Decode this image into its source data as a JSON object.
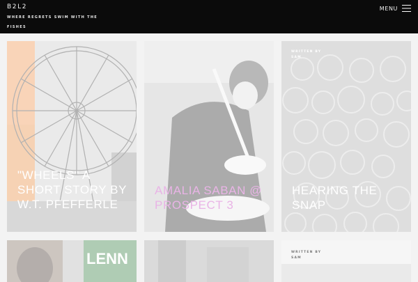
{
  "site": {
    "logo": "B2L2",
    "tagline": "Where regrets swim with the fishes",
    "menu_label": "MENU"
  },
  "colors": {
    "header_bg": "#0b0b0b",
    "page_bg": "#f3f3f3",
    "title_white": "#ffffff",
    "title_pink": "#e9b4e6"
  },
  "cards": [
    {
      "title": "\"Wheels\" A Short Story by W.T. Pfefferle",
      "meta": ""
    },
    {
      "title": "Amalia Saban @ Prospect 3",
      "meta": ""
    },
    {
      "title": "Hearing the Snap",
      "meta": "Written by Sam"
    },
    {
      "title": "",
      "meta": ""
    },
    {
      "title": "",
      "meta": ""
    },
    {
      "title": "",
      "meta": "Written by Sam"
    }
  ]
}
